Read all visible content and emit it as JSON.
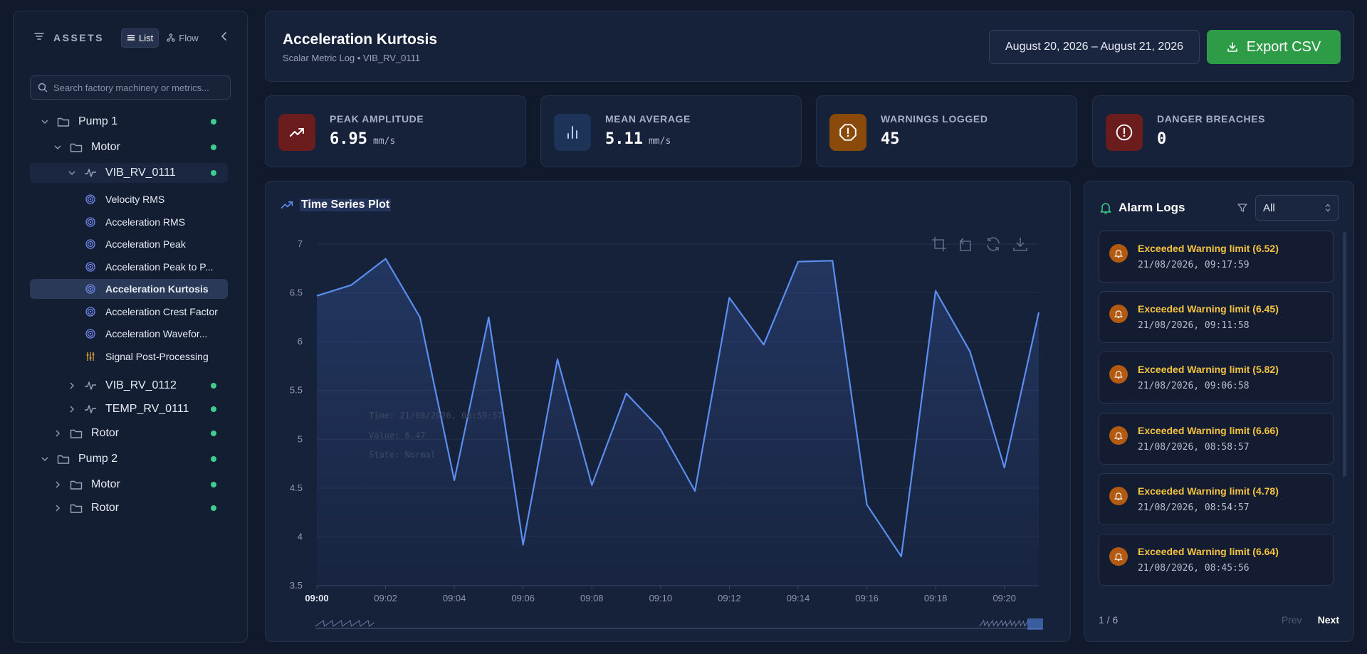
{
  "sidebar": {
    "title": "ASSETS",
    "view_list": "List",
    "view_flow": "Flow",
    "search_placeholder": "Search factory machinery or metrics...",
    "tree": [
      {
        "label": "Pump 1"
      },
      {
        "label": "Motor"
      },
      {
        "label": "VIB_RV_0111"
      },
      {
        "label": "VIB_RV_0112"
      },
      {
        "label": "TEMP_RV_0111"
      },
      {
        "label": "Rotor"
      },
      {
        "label": "Pump 2"
      },
      {
        "label": "Motor"
      },
      {
        "label": "Rotor"
      }
    ],
    "metrics": [
      {
        "label": "Velocity RMS"
      },
      {
        "label": "Acceleration RMS"
      },
      {
        "label": "Acceleration Peak"
      },
      {
        "label": "Acceleration Peak to P..."
      },
      {
        "label": "Acceleration Kurtosis"
      },
      {
        "label": "Acceleration Crest Factor"
      },
      {
        "label": "Acceleration Wavefor..."
      },
      {
        "label": "Signal Post-Processing"
      }
    ]
  },
  "header": {
    "title": "Acceleration Kurtosis",
    "subtitle": "Scalar Metric Log • VIB_RV_0111",
    "date_range": "August 20, 2026 – August 21, 2026",
    "export_label": "Export CSV"
  },
  "kpis": [
    {
      "label": "PEAK AMPLITUDE",
      "value": "6.95",
      "unit": "mm/s",
      "color": "#6b1d1d"
    },
    {
      "label": "MEAN AVERAGE",
      "value": "5.11",
      "unit": "mm/s",
      "color": "#1e3358"
    },
    {
      "label": "WARNINGS LOGGED",
      "value": "45",
      "unit": "",
      "color": "#8a4a0a"
    },
    {
      "label": "DANGER BREACHES",
      "value": "0",
      "unit": "",
      "color": "#6b1d1d"
    }
  ],
  "chart_panel": {
    "title": "Time Series Plot",
    "tooltip": {
      "time": "Time: 21/08/2026, 08:59:57",
      "value": "Value: 6.47",
      "state": "State: Normal"
    }
  },
  "chart_data": {
    "type": "area",
    "x": [
      "09:00",
      "09:01",
      "09:02",
      "09:03",
      "09:04",
      "09:05",
      "09:06",
      "09:07",
      "09:08",
      "09:09",
      "09:10",
      "09:11",
      "09:12",
      "09:13",
      "09:14",
      "09:15",
      "09:16",
      "09:17",
      "09:18",
      "09:19",
      "09:20",
      "09:21"
    ],
    "tick_labels": [
      "09:00",
      "09:02",
      "09:04",
      "09:06",
      "09:08",
      "09:10",
      "09:12",
      "09:14",
      "09:16",
      "09:18",
      "09:20"
    ],
    "values": [
      6.47,
      6.58,
      6.85,
      6.25,
      4.58,
      6.25,
      3.92,
      5.82,
      4.53,
      5.47,
      5.1,
      4.47,
      6.45,
      5.97,
      6.82,
      6.83,
      4.33,
      3.8,
      6.52,
      5.9,
      4.71,
      6.3
    ],
    "yticks": [
      3.5,
      4,
      4.5,
      5,
      5.5,
      6,
      6.5,
      7
    ],
    "ylim": [
      3.5,
      7
    ],
    "grid": true,
    "line_color": "#5b8ef0"
  },
  "alarms": {
    "title": "Alarm Logs",
    "filter_value": "All",
    "items": [
      {
        "title": "Exceeded Warning limit (6.52)",
        "time": "21/08/2026, 09:17:59"
      },
      {
        "title": "Exceeded Warning limit (6.45)",
        "time": "21/08/2026, 09:11:58"
      },
      {
        "title": "Exceeded Warning limit (5.82)",
        "time": "21/08/2026, 09:06:58"
      },
      {
        "title": "Exceeded Warning limit (6.66)",
        "time": "21/08/2026, 08:58:57"
      },
      {
        "title": "Exceeded Warning limit (4.78)",
        "time": "21/08/2026, 08:54:57"
      },
      {
        "title": "Exceeded Warning limit (6.64)",
        "time": "21/08/2026, 08:45:56"
      }
    ],
    "page": "1 / 6",
    "prev": "Prev",
    "next": "Next"
  }
}
